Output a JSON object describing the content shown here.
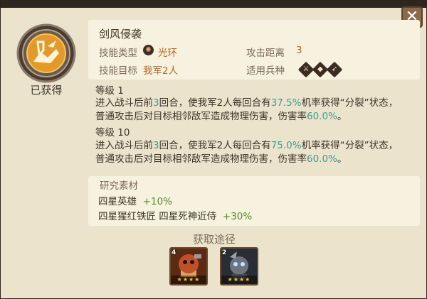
{
  "skill": {
    "name": "剑风侵袭",
    "obtained_label": "已获得",
    "type_label": "技能类型",
    "type_value": "光环",
    "range_label": "攻击距离",
    "range_value": "3",
    "target_label": "技能目标",
    "target_value": "我军2人",
    "troops_label": "适用兵种",
    "troop_icons": [
      "sword-icon",
      "shield-icon",
      "bow-icon"
    ]
  },
  "levels": [
    {
      "label": "等级 1",
      "desc_parts": [
        "进入战斗后前",
        "3",
        "回合，使我军2人每回合有",
        "37.5%",
        "机率获得“分裂”状态，",
        "普通攻击后对目标相邻敌军造成物理伤害，伤害率",
        "60.0%",
        "。"
      ]
    },
    {
      "label": "等级 10",
      "desc_parts": [
        "进入战斗后前",
        "3",
        "回合，使我军2人每回合有",
        "75.0%",
        "机率获得“分裂”状态，",
        "普通攻击后对目标相邻敌军造成物理伤害，伤害率",
        "60.0%",
        "。"
      ]
    }
  ],
  "research": {
    "title": "研究素材",
    "rows": [
      {
        "heroes": "四星英雄",
        "bonus": "+10%"
      },
      {
        "heroes": "四星猩红铁匠 四星死神近侍",
        "bonus": "+30%"
      }
    ]
  },
  "obtain": {
    "title": "获取途径",
    "heroes": [
      {
        "name": "hero-red-blacksmith",
        "stars": "★★★★",
        "level_tag": "4"
      },
      {
        "name": "hero-death-attendant",
        "stars": "★★★★",
        "level_tag": "2"
      }
    ]
  },
  "colors": {
    "highlight": "#3aa08c",
    "accent_orange": "#b86a22",
    "bonus_green": "#4e8f2a",
    "star_gold": "#f5c02f"
  }
}
